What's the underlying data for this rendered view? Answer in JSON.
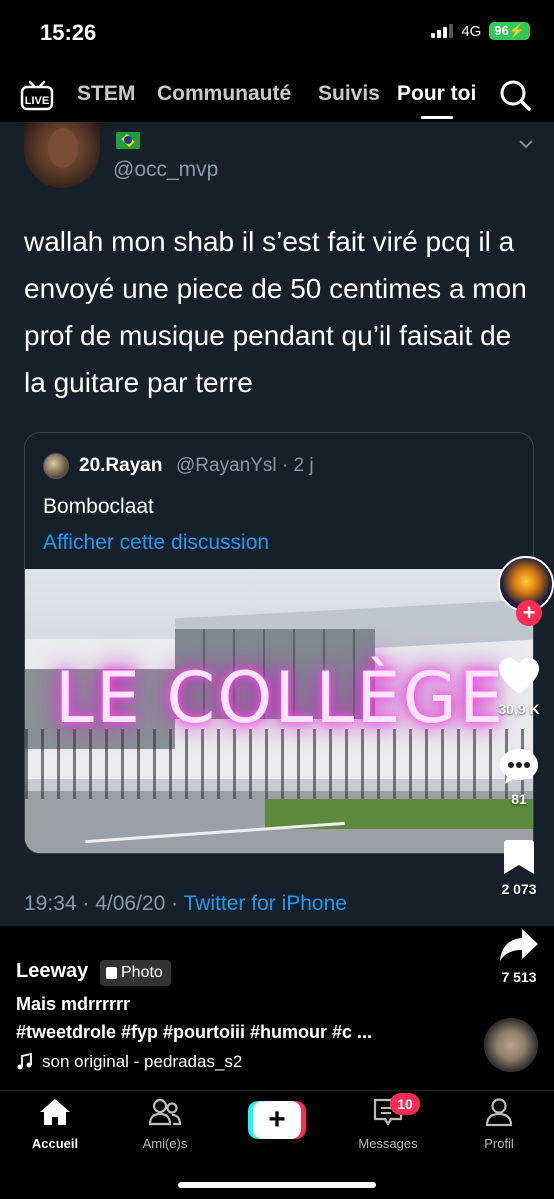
{
  "status": {
    "time": "15:26",
    "network": "4G",
    "battery": "96"
  },
  "topnav": {
    "live_label": "LIVE",
    "tabs": [
      "STEM",
      "Communauté",
      "Suivis",
      "Pour toi"
    ],
    "active_tab": "Pour toi"
  },
  "tweet": {
    "handle": "@occ_mvp",
    "text": "wallah mon shab il s’est fait viré pcq il a envoyé une piece de 50 centimes a mon prof de musique pendant qu’il faisait de la guitare par terre",
    "quote": {
      "name": "20.Rayan",
      "handle": "@RayanYsl · 2 j",
      "text": "Bomboclaat",
      "link": "Afficher cette discussion",
      "overlay_text": "LE COLLÈGE"
    },
    "meta_time": "19:34 · 4/06/20 · ",
    "meta_source": "Twitter for iPhone"
  },
  "rail": {
    "likes": "30,9 K",
    "comments": "81",
    "saves": "2 073",
    "shares": "7 513",
    "follow_symbol": "+"
  },
  "post": {
    "username": "Leeway",
    "badge": "Photo",
    "caption": "Mais mdrrrrrr",
    "hashtags": "#tweetdrole #fyp #pourtoiii #humour #c ...",
    "sound": "son original - pedradas_s2"
  },
  "tabbar": {
    "home": "Accueil",
    "friends": "Ami(e)s",
    "create_symbol": "+",
    "messages": "Messages",
    "messages_badge": "10",
    "profile": "Profil"
  },
  "colors": {
    "tweet_bg": "#15202b",
    "twitter_blue": "#1d9bf0",
    "tiktok_red": "#fe2c55",
    "tiktok_cyan": "#25f4ee",
    "battery_green": "#34c759"
  }
}
